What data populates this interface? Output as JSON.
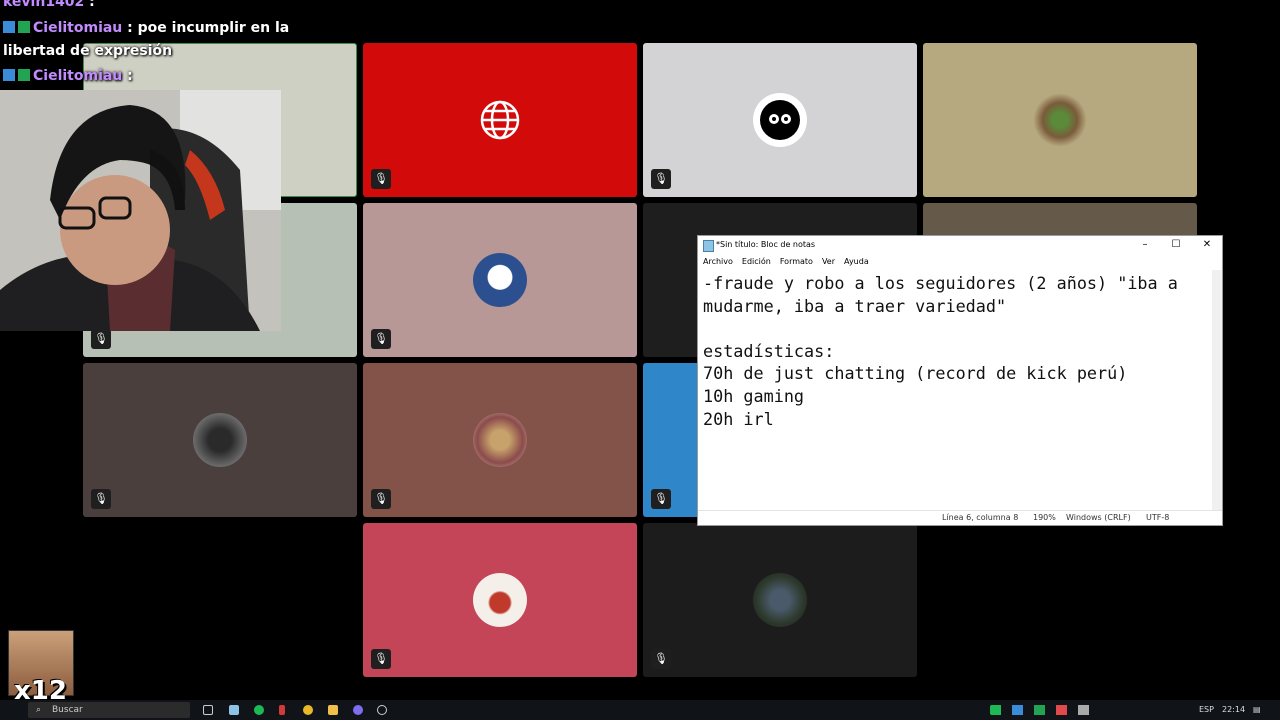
{
  "chat": {
    "line1": {
      "user": "kevin1402",
      "sep": " :"
    },
    "line2": {
      "user": "Cielitomiau",
      "text": " : poe incumplir en la"
    },
    "line3": {
      "text": "libertad de expresión"
    },
    "line4": {
      "user": "Cielitomiau",
      "sep": " :"
    }
  },
  "notepad": {
    "title": "*Sin título: Bloc de notas",
    "menu": [
      "Archivo",
      "Edición",
      "Formato",
      "Ver",
      "Ayuda"
    ],
    "text": "-fraude y robo a los seguidores (2 años) \"iba a\nmudarme, iba a traer variedad\"\n\nestadísticas:\n70h de just chatting (record de kick perú)\n10h gaming\n20h irl",
    "status": {
      "position": "Línea 6, columna 8",
      "zoom": "190%",
      "line_ending": "Windows (CRLF)",
      "encoding": "UTF-8"
    },
    "controls": {
      "minimize": "–",
      "maximize": "☐",
      "close": "✕"
    }
  },
  "overlay": {
    "multiplier": "x12"
  },
  "taskbar": {
    "search_placeholder": "Buscar",
    "lang": "ESP",
    "time": "22:14"
  },
  "colors": {
    "tile1": "#cfd0c4",
    "tile2": "#d20a0a",
    "tile3": "#d3d3d5",
    "tile4": "#b7a97f",
    "tile5": "#b7c0b4",
    "tile6": "#b89897",
    "tile7": "#1e1e1e",
    "tile8": "#655a4a",
    "tile9": "#4a3f3c",
    "tile10": "#835249",
    "tile11": "#2f86c9",
    "tile12": "#c44458",
    "tile13": "#1c1c1c"
  }
}
